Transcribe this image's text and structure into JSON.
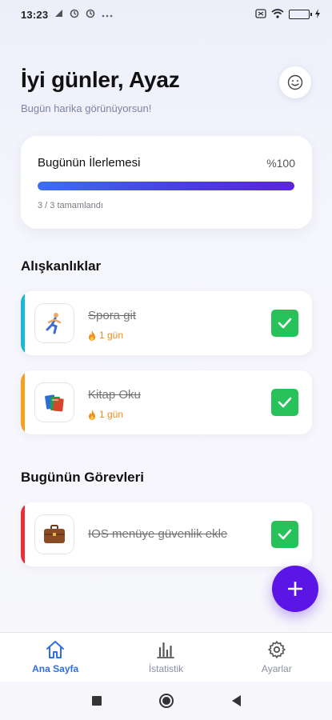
{
  "status_bar": {
    "time": "13:23",
    "left_icons": [
      "signal-icon",
      "sync-icon",
      "sync-icon",
      "more-icon"
    ],
    "right_icons": [
      "sim-icon",
      "wifi-icon",
      "battery-icon",
      "charging-icon"
    ],
    "battery_level": 1.0
  },
  "header": {
    "greeting": "İyi günler, Ayaz",
    "subtitle": "Bugün harika görünüyorsun!",
    "profile_icon": "smiley-icon"
  },
  "progress": {
    "title": "Bugünün İlerlemesi",
    "percent_label": "%100",
    "fraction": 1.0,
    "summary": "3 / 3 tamamlandı"
  },
  "habits": {
    "title": "Alışkanlıklar",
    "items": [
      {
        "label": "Spora git",
        "streak": "1 gün",
        "icon": "runner-icon",
        "accent": "#1ab8d4",
        "done": true
      },
      {
        "label": "Kitap Oku",
        "streak": "1 gün",
        "icon": "books-icon",
        "accent": "#f4a020",
        "done": true
      }
    ]
  },
  "tasks": {
    "title": "Bugünün Görevleri",
    "items": [
      {
        "label": "IOS menüye güvenlik ekle",
        "icon": "briefcase-icon",
        "accent": "#e8303a",
        "done": true
      }
    ]
  },
  "fab": {
    "icon": "plus-icon"
  },
  "bottom_nav": {
    "items": [
      {
        "label": "Ana Sayfa",
        "icon": "home-icon",
        "active": true
      },
      {
        "label": "İstatistik",
        "icon": "bar-chart-icon",
        "active": false
      },
      {
        "label": "Ayarlar",
        "icon": "gear-icon",
        "active": false
      }
    ]
  },
  "colors": {
    "accent_blue": "#2f6fe4",
    "fab_purple": "#5b16e6",
    "check_green": "#27c25a",
    "streak_orange": "#ef8a1b"
  }
}
